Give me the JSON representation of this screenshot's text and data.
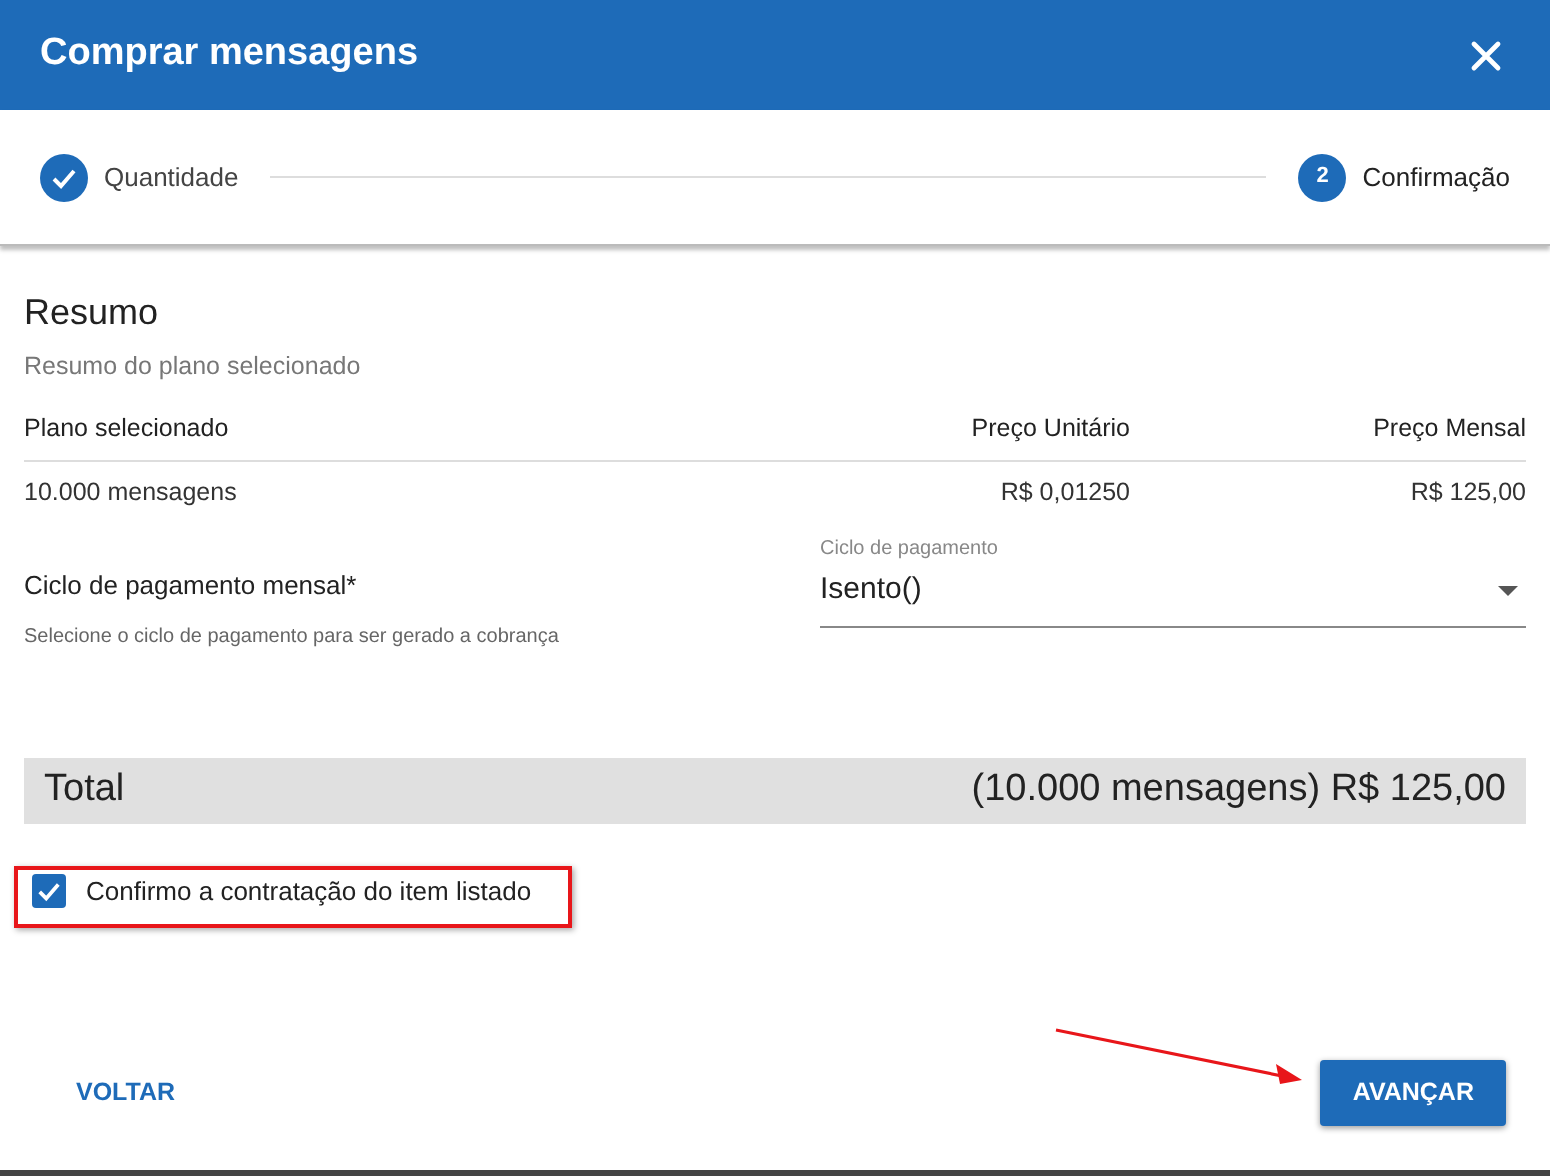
{
  "dialog": {
    "title": "Comprar mensagens"
  },
  "steps": [
    {
      "label": "Quantidade",
      "completed": true,
      "selected": false
    },
    {
      "label": "Confirmação",
      "number": "2",
      "completed": false,
      "selected": true
    }
  ],
  "summary": {
    "title": "Resumo",
    "subtitle": "Resumo do plano selecionado",
    "table": {
      "columns": [
        "Plano selecionado",
        "Preço Unitário",
        "Preço Mensal"
      ],
      "rows": [
        [
          "10.000 mensagens",
          "R$ 0,01250",
          "R$ 125,00"
        ]
      ]
    }
  },
  "payment": {
    "label": "Ciclo de pagamento mensal*",
    "hint": "Selecione o ciclo de pagamento para ser gerado a cobrança",
    "field_label": "Ciclo de pagamento",
    "value": "Isento()"
  },
  "total": {
    "label": "Total",
    "value": "(10.000 mensagens) R$ 125,00"
  },
  "confirm": {
    "label": "Confirmo a contratação do item listado",
    "checked": true
  },
  "buttons": [
    {
      "label": "VOLTAR",
      "kind": "text"
    },
    {
      "label": "AVANÇAR",
      "kind": "primary"
    }
  ]
}
